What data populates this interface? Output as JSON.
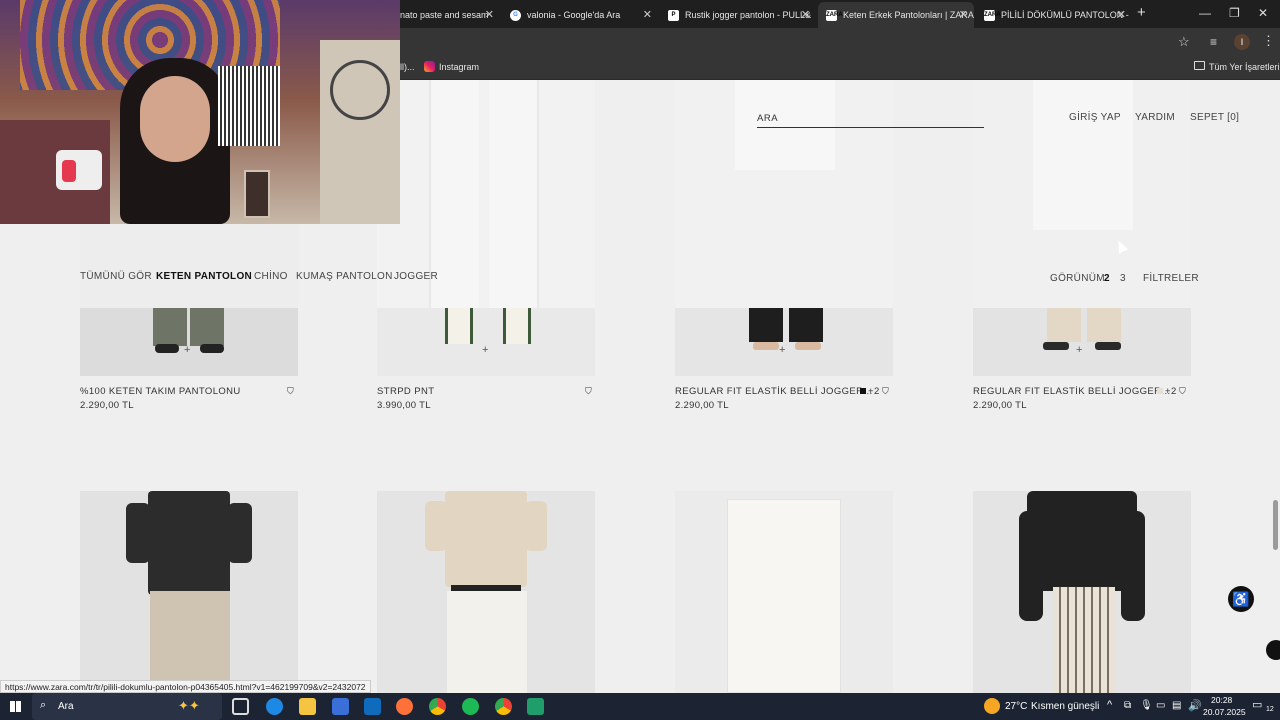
{
  "browser": {
    "tabs": [
      {
        "title": "nato paste and sesam",
        "favicon": ""
      },
      {
        "title": "valonia - Google'da Ara",
        "favicon": "G"
      },
      {
        "title": "Rustik jogger pantolon - PULL&",
        "favicon": "P"
      },
      {
        "title": "Keten Erkek Pantolonları | ZARA",
        "favicon": "ZARA"
      },
      {
        "title": "PİLİLİ DÖKÜMLÜ PANTOLON -",
        "favicon": "ZARA"
      }
    ],
    "bookmarks": [
      {
        "label": "ll)..."
      },
      {
        "label": "Instagram"
      }
    ],
    "all_bookmarks_label": "Tüm Yer İşaretleri",
    "profile_initial": "I",
    "status_url": "https://www.zara.com/tr/tr/pilili-dokumlu-pantolon-p04365405.html?v1=462199709&v2=2432072"
  },
  "header": {
    "search_placeholder": "ARA",
    "login": "GİRİŞ YAP",
    "help": "YARDIM",
    "cart": "SEPET [0]"
  },
  "categories": [
    "TÜMÜNÜ GÖR",
    "KETEN PANTOLON",
    "CHİNO",
    "KUMAŞ PANTOLON",
    "JOGGER"
  ],
  "view": {
    "label": "GÖRÜNÜM",
    "options": [
      "2",
      "3"
    ],
    "filters": "FİLTRELER"
  },
  "products_row1": [
    {
      "name": "%100 KETEN TAKIM PANTOLONU",
      "price": "2.290,00 TL",
      "colors": ""
    },
    {
      "name": "STRPD PNT",
      "price": "3.990,00 TL",
      "colors": ""
    },
    {
      "name": "REGULAR FIT ELASTİK BELLİ JOGGER...",
      "price": "2.290,00 TL",
      "colors": "+2"
    },
    {
      "name": "REGULAR FIT ELASTİK BELLİ JOGGER...",
      "price": "2.290,00 TL",
      "colors": "+2"
    }
  ],
  "taskbar": {
    "search": "Ara",
    "weather_temp": "27°C",
    "weather_text": "Kısmen güneşli",
    "time": "20:28",
    "date": "20.07.2025",
    "notif_count": "12"
  }
}
